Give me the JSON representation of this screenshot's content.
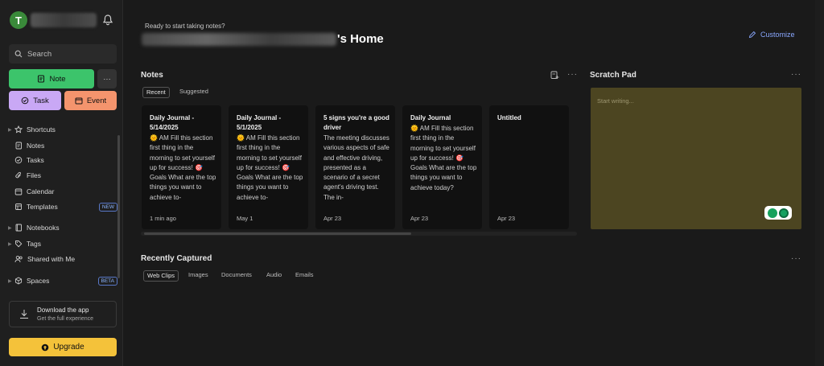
{
  "sidebar": {
    "avatar_letter": "T",
    "search_placeholder": "Search",
    "note_label": "Note",
    "more_label": "···",
    "task_label": "Task",
    "event_label": "Event",
    "nav": [
      {
        "label": "Shortcuts",
        "icon": "star-icon"
      },
      {
        "label": "Notes",
        "icon": "note-icon"
      },
      {
        "label": "Tasks",
        "icon": "check-circle-icon"
      },
      {
        "label": "Files",
        "icon": "paperclip-icon"
      },
      {
        "label": "Calendar",
        "icon": "calendar-icon"
      },
      {
        "label": "Templates",
        "icon": "template-icon",
        "badge": "NEW"
      },
      {
        "label": "Notebooks",
        "icon": "notebook-icon"
      },
      {
        "label": "Tags",
        "icon": "tag-icon"
      },
      {
        "label": "Shared with Me",
        "icon": "people-icon"
      },
      {
        "label": "Spaces",
        "icon": "cube-icon",
        "badge": "BETA"
      }
    ],
    "download_title": "Download the app",
    "download_sub": "Get the full experience",
    "upgrade_label": "Upgrade"
  },
  "main": {
    "kicker": "Ready to start taking notes?",
    "home_suffix": "'s Home",
    "customize_label": "Customize"
  },
  "notes": {
    "title": "Notes",
    "tabs": [
      "Recent",
      "Suggested"
    ],
    "cards": [
      {
        "title": "Daily Journal - 5/14/2025",
        "body": "🌞 AM Fill this section first thing in the morning to set yourself up for success! 🎯 Goals What are the top things you want to achieve to-",
        "date": "1 min ago"
      },
      {
        "title": "Daily Journal - 5/1/2025",
        "body": "🌞 AM Fill this section first thing in the morning to set yourself up for success! 🎯 Goals What are the top things you want to achieve to-",
        "date": "May 1"
      },
      {
        "title": "5 signs you're a good driver",
        "body": "The meeting discusses various aspects of safe and effective driving, presented as a scenario of a secret agent's driving test. The in-",
        "date": "Apr 23"
      },
      {
        "title": "Daily Journal",
        "body": "🌞 AM Fill this section first thing in the morning to set yourself up for success! 🎯 Goals What are the top things you want to achieve today? Example ... 💚 ...",
        "date": "Apr 23"
      },
      {
        "title": "Untitled",
        "body": "",
        "date": "Apr 23"
      }
    ]
  },
  "scratch": {
    "title": "Scratch Pad",
    "placeholder": "Start writing..."
  },
  "recent": {
    "title": "Recently Captured",
    "tabs": [
      "Web Clips",
      "Images",
      "Documents",
      "Audio",
      "Emails"
    ]
  },
  "colors": {
    "note": "#3cc46b",
    "task": "#c9a8f5",
    "event": "#f4946d",
    "upgrade": "#f4c23a",
    "scratch_bg": "#4c4521",
    "accent": "#8aa8ff"
  }
}
